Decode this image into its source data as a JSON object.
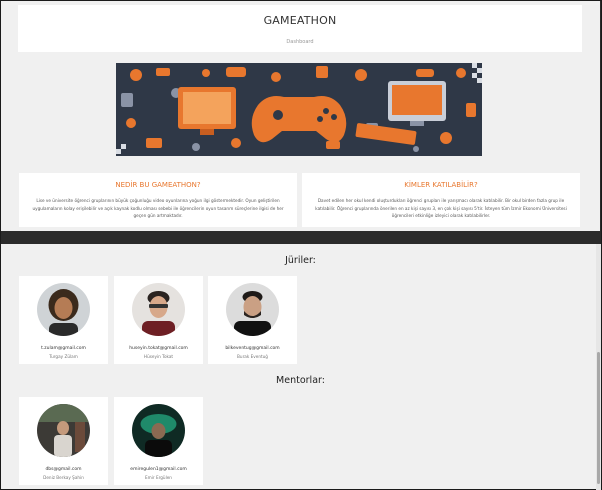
{
  "header": {
    "title": "GAMEATHON",
    "breadcrumb": "Dashboard"
  },
  "cards": [
    {
      "title": "NEDİR BU GAMEATHON?",
      "text": "Lise ve üniversite öğrenci gruplarının büyük çoğunluğu video oyunlarına yoğun ilgi göstermektedir. Oyun geliştirilen uygulamaların kolay erişilebilir ve açık kaynak kodlu olması sebebi ile öğrencilerin oyun tasarım süreçlerine ilgisi de her geçen gün artmaktadır."
    },
    {
      "title": "KİMLER KATILABİLİR?",
      "text": "Davet edilen her okul kendi oluşturdukları öğrenci grupları ile yarışmacı olarak katılabilir. Bir okul birden fazla grup ile katılabilir. Öğrenci gruplarında önerilen en az kişi sayısı 3, en çok kişi sayısı 5'tir. İsteyen tüm İzmir Ekonomi Üniversitesi öğrencileri etkinliğe izleyici olarak katılabilirler."
    }
  ],
  "juries": {
    "title": "Jüriler:",
    "people": [
      {
        "email": "t.zulam@gmail.com",
        "name": "Turgay Zülam"
      },
      {
        "email": "huseyin.tokat@gmail.com",
        "name": "Hüseyin Tokat"
      },
      {
        "email": "bilkeventug@gmail.com",
        "name": "Burak Eventuğ"
      }
    ]
  },
  "mentors": {
    "title": "Mentorlar:",
    "people": [
      {
        "email": "dbs@gmail.com",
        "name": "Deniz Berkay Şahin"
      },
      {
        "email": "emiregulen1@gmail.com",
        "name": "Emir Ergülen"
      }
    ]
  },
  "colors": {
    "accent": "#e8772e",
    "banner_bg": "#2f3847",
    "page_bg": "#f0f0f0",
    "dark_bar": "#2b2b2b"
  }
}
